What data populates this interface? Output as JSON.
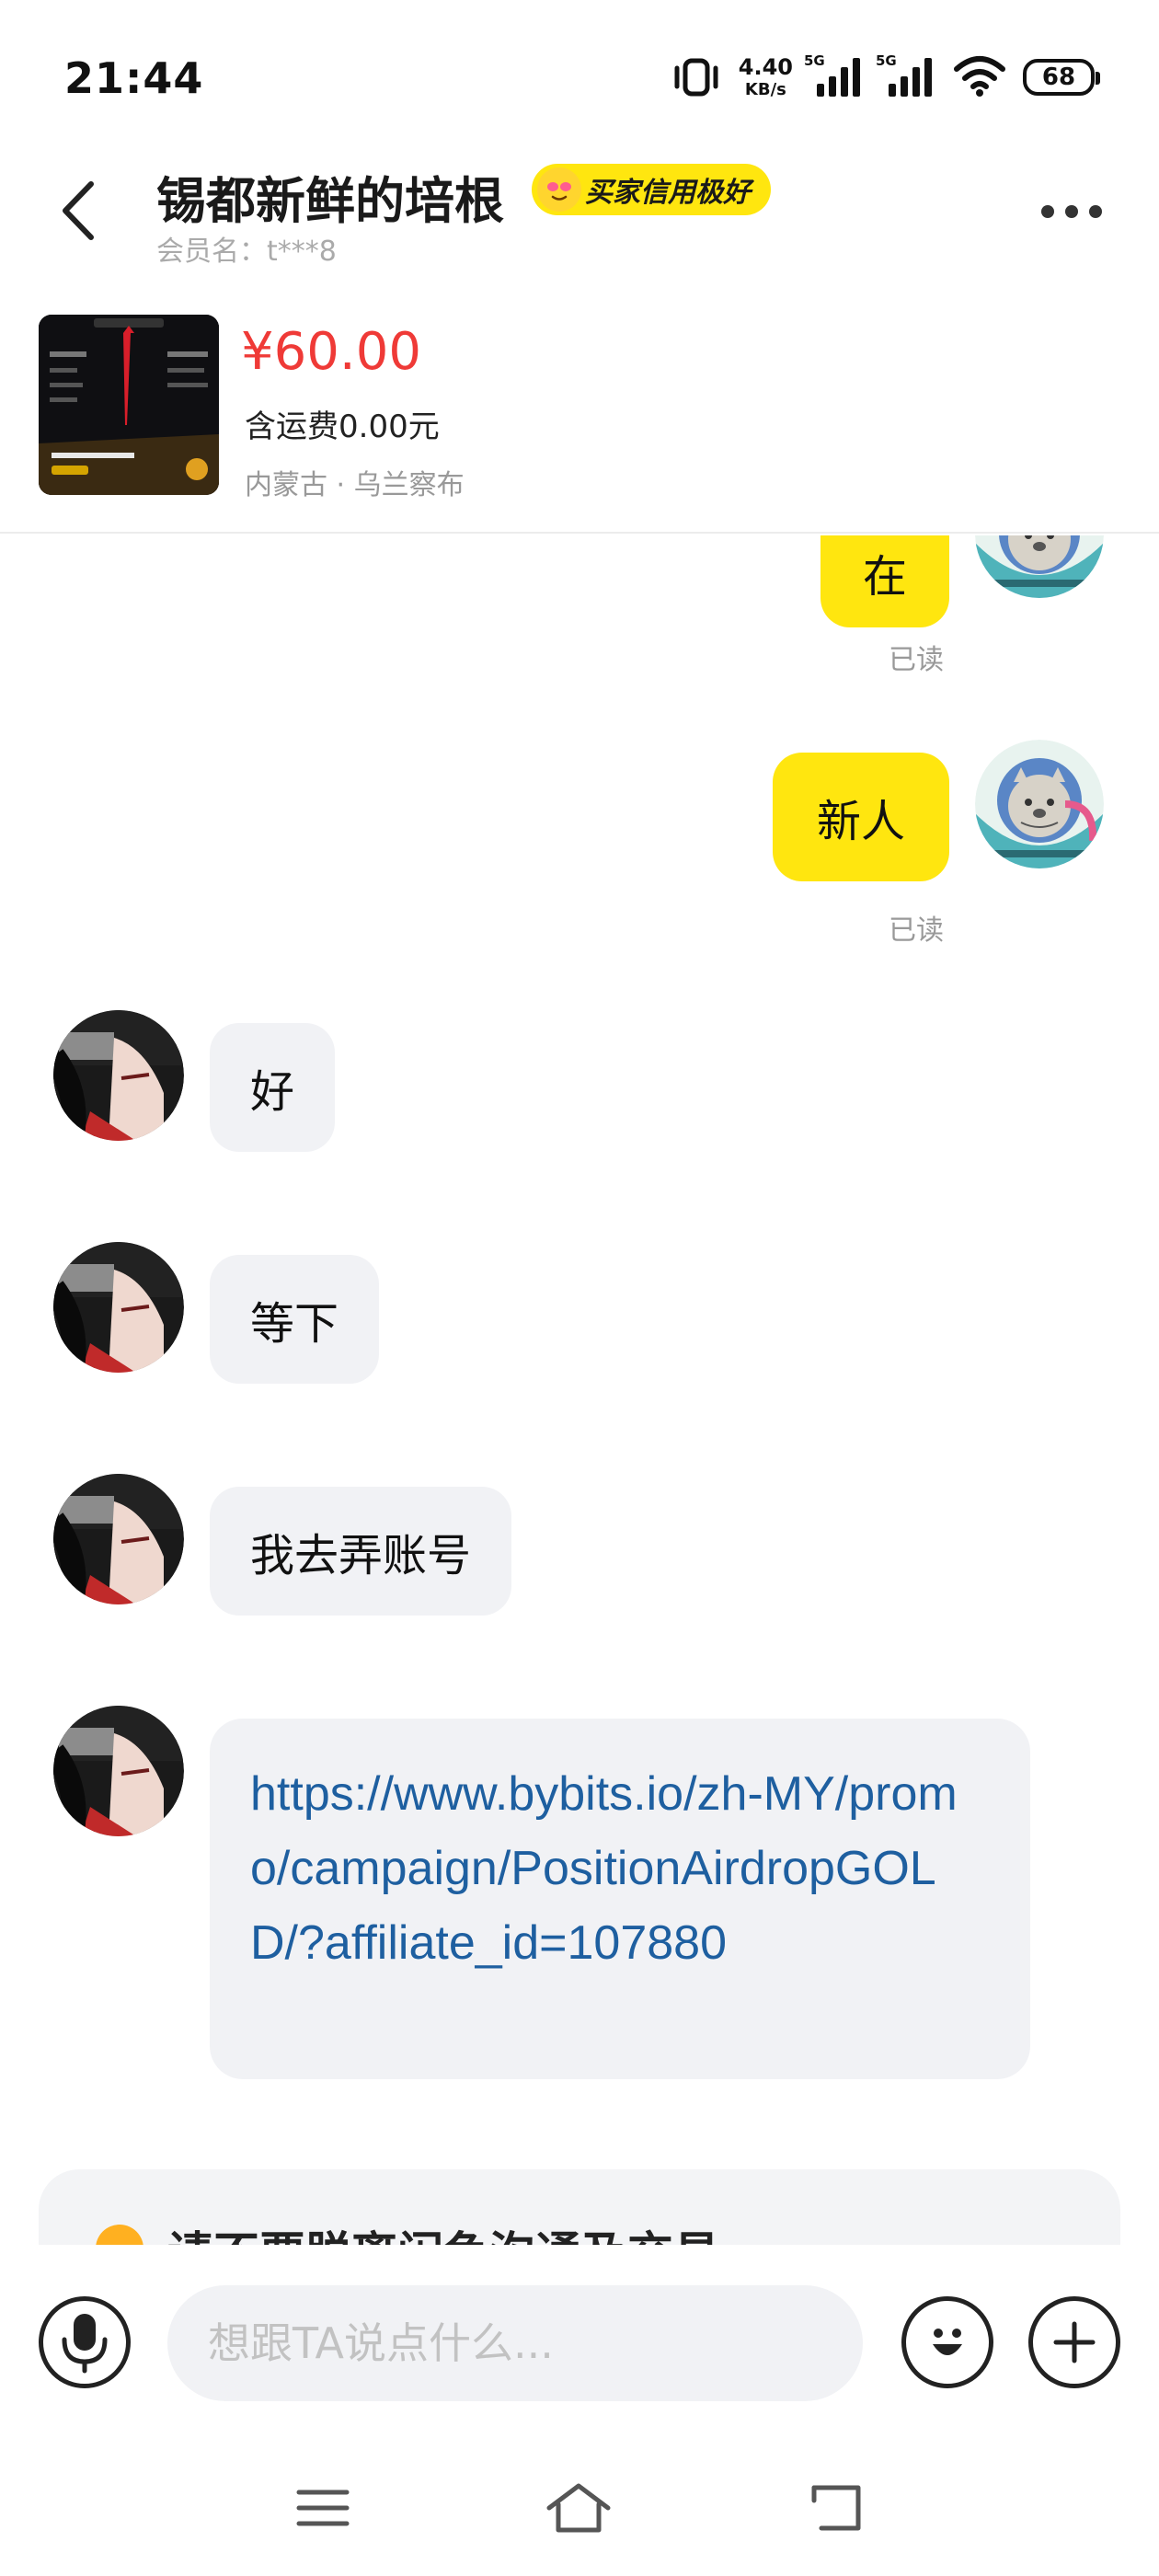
{
  "status_bar": {
    "time": "21:44",
    "net_speed_value": "4.40",
    "net_speed_unit": "KB/s",
    "sim1_label": "5G",
    "sim2_label": "5G",
    "battery_level": "68",
    "icons": [
      "vibrate-icon",
      "signal-icon",
      "signal-icon",
      "wifi-icon",
      "battery-icon"
    ]
  },
  "header": {
    "seller_name": "锡都新鲜的培根",
    "credit_badge": "买家信用极好",
    "member_id": "会员名：t***8",
    "icons": [
      "back-arrow-icon",
      "emoji-icon",
      "more-icon"
    ]
  },
  "product": {
    "price": "¥60.00",
    "shipping": "含运费0.00元",
    "location": "内蒙古 · 乌兰察布"
  },
  "messages": {
    "out_1_text": "在",
    "out_1_status": "已读",
    "out_2_text": "新人",
    "out_2_status": "已读",
    "in_1_text": "好",
    "in_2_text": "等下",
    "in_3_text": "我去弄账号",
    "in_4_link": "https://www.bybits.io/zh-MY/promo/campaign/PositionAirdropGOLD/?affiliate_id=107880"
  },
  "notice": {
    "text": "请不要脱离闲鱼沟通及交易",
    "icon": "warning-icon"
  },
  "input_bar": {
    "placeholder": "想跟TA说点什么...",
    "icons": [
      "microphone-icon",
      "emoji-icon",
      "plus-icon"
    ]
  },
  "nav_bar": {
    "icons": [
      "menu-icon",
      "home-icon",
      "back-icon"
    ]
  },
  "colors": {
    "accent_yellow": "#ffe60f",
    "price_red": "#ef3a37",
    "link_blue": "#1e5fa0",
    "bubble_gray": "#f1f2f5"
  }
}
